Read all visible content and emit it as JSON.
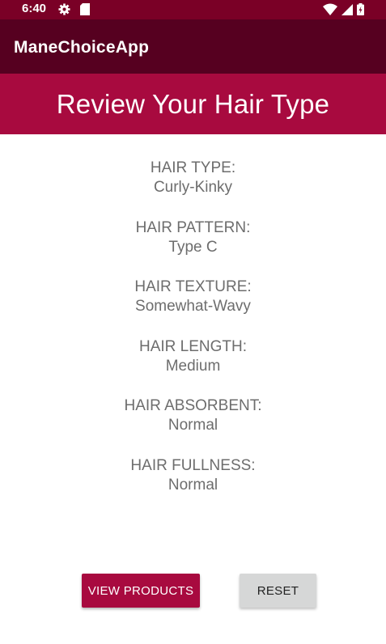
{
  "status_bar": {
    "time": "6:40",
    "left_icons": [
      "gear-icon",
      "sd-card-icon"
    ],
    "right_icons": [
      "wifi-icon",
      "signal-icon",
      "battery-icon"
    ]
  },
  "app_bar": {
    "title": "ManeChoiceApp"
  },
  "header": {
    "title": "Review Your Hair Type"
  },
  "details": [
    {
      "label": "HAIR TYPE:",
      "value": "Curly-Kinky"
    },
    {
      "label": "HAIR PATTERN:",
      "value": "Type C"
    },
    {
      "label": "HAIR TEXTURE:",
      "value": "Somewhat-Wavy"
    },
    {
      "label": "HAIR LENGTH:",
      "value": "Medium"
    },
    {
      "label": "HAIR ABSORBENT:",
      "value": "Normal"
    },
    {
      "label": "HAIR FULLNESS:",
      "value": "Normal"
    }
  ],
  "buttons": {
    "view_products": "VIEW PRODUCTS",
    "reset": "RESET"
  },
  "colors": {
    "status_bar": "#7a0026",
    "app_bar": "#560020",
    "accent": "#a80a3f",
    "secondary_button": "#d6d7d7",
    "detail_text": "#6d6d6d"
  }
}
